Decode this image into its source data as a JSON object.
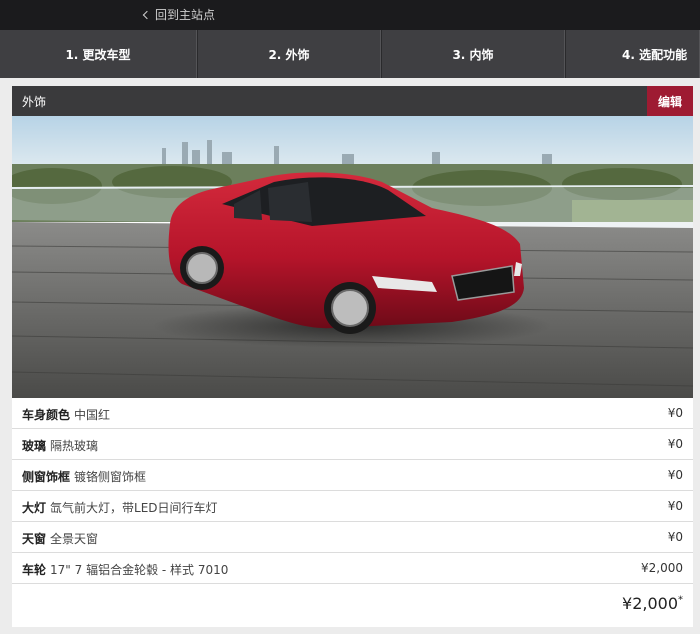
{
  "topbar": {
    "back_label": "回到主站点"
  },
  "steps": [
    {
      "label": "1. 更改车型"
    },
    {
      "label": "2. 外饰"
    },
    {
      "label": "3. 内饰"
    },
    {
      "label": "4. 选配功能"
    }
  ],
  "panel": {
    "title": "外饰",
    "edit_label": "编辑"
  },
  "specs": [
    {
      "name": "车身颜色",
      "value": "中国红",
      "price": "¥0"
    },
    {
      "name": "玻璃",
      "value": "隔热玻璃",
      "price": "¥0"
    },
    {
      "name": "侧窗饰框",
      "value": "镀铬侧窗饰框",
      "price": "¥0"
    },
    {
      "name": "大灯",
      "value": "氙气前大灯，带LED日间行车灯",
      "price": "¥0"
    },
    {
      "name": "天窗",
      "value": "全景天窗",
      "price": "¥0"
    },
    {
      "name": "车轮",
      "value": "17\" 7 辐铝合金轮毂 - 样式 7010",
      "price": "¥2,000"
    }
  ],
  "total": {
    "amount": "¥2,000",
    "mark": "*"
  },
  "colors": {
    "accent": "#9e1b32",
    "car_body": "#b5142a",
    "header_bg": "#3a3a3c"
  }
}
